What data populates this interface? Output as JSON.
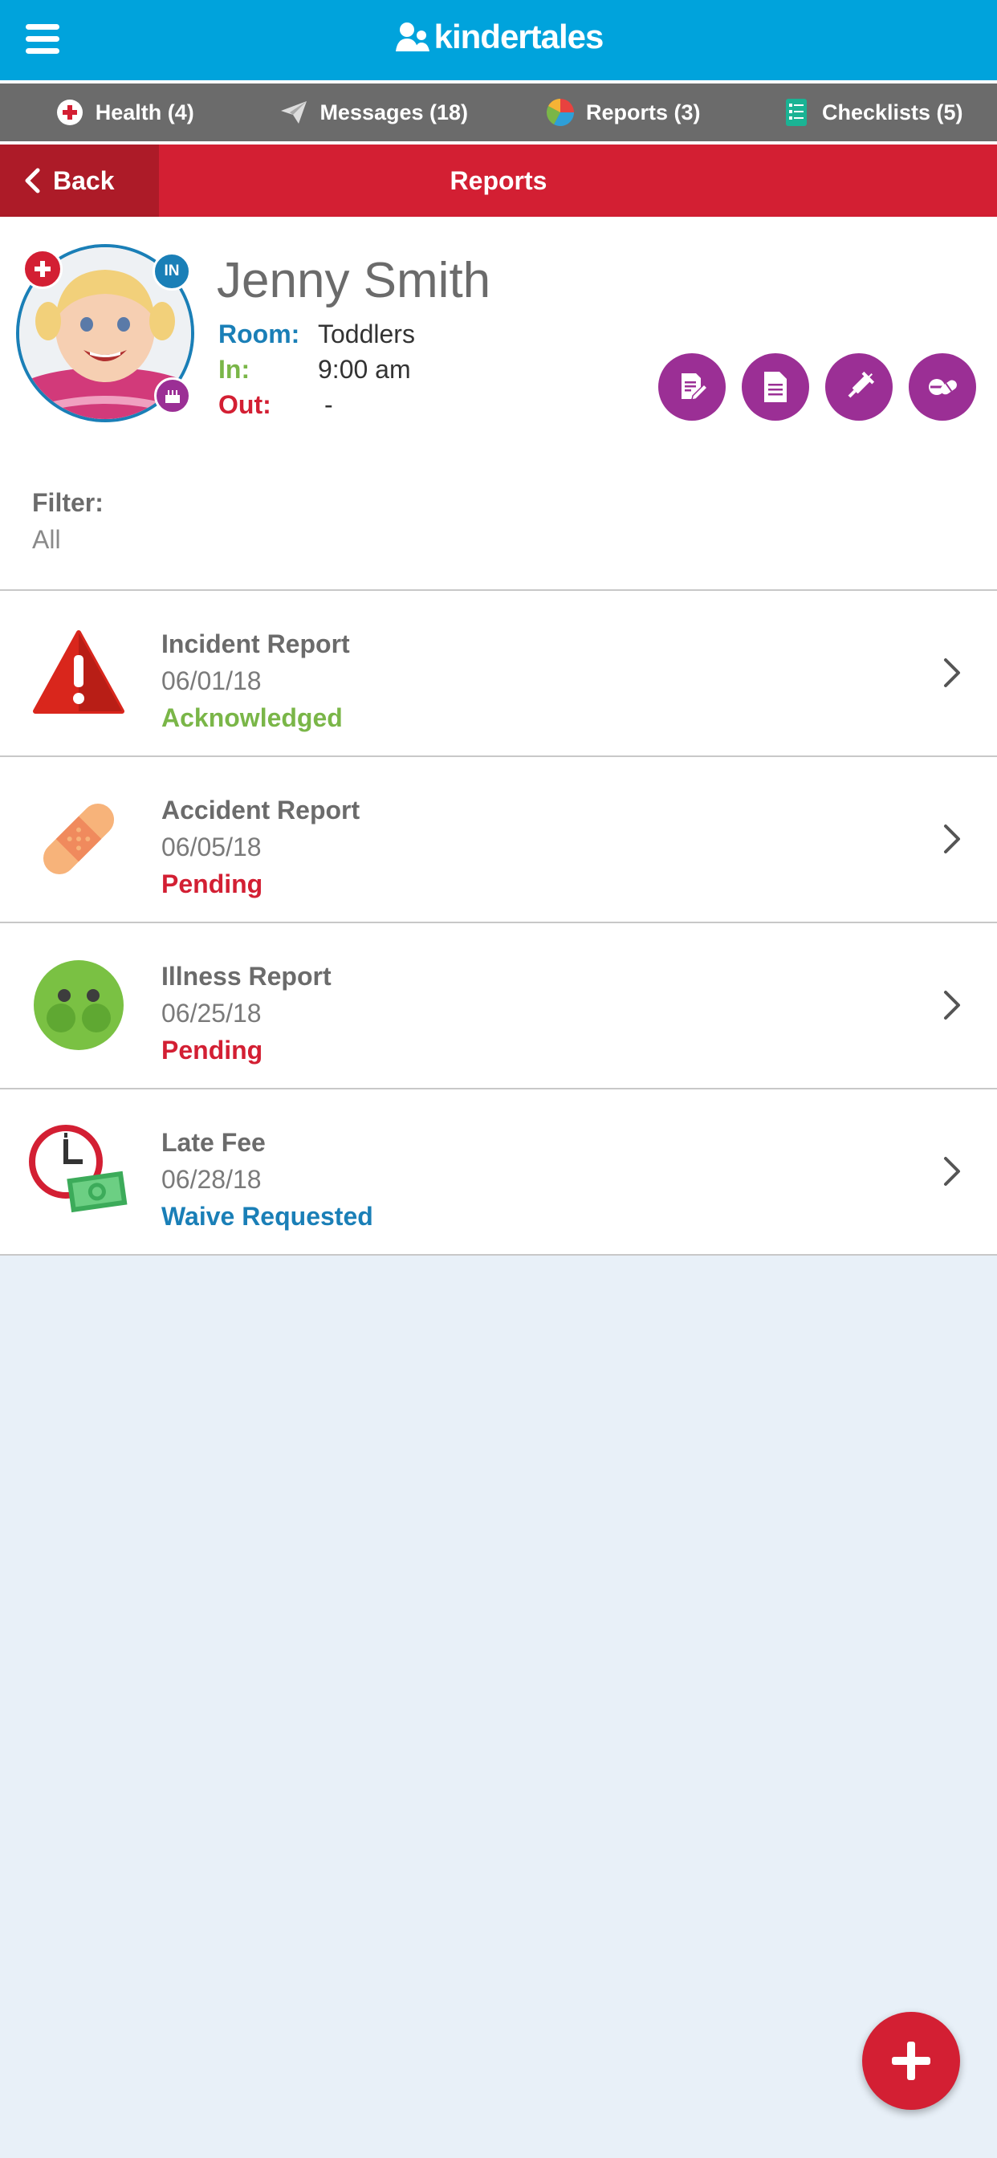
{
  "app": {
    "brand": "kindertales"
  },
  "tabs": [
    {
      "label": "Health (4)",
      "icon": "health-icon"
    },
    {
      "label": "Messages (18)",
      "icon": "send-icon"
    },
    {
      "label": "Reports (3)",
      "icon": "pie-chart-icon"
    },
    {
      "label": "Checklists (5)",
      "icon": "checklist-icon"
    }
  ],
  "header": {
    "back_label": "Back",
    "title": "Reports"
  },
  "child": {
    "name": "Jenny Smith",
    "in_badge": "IN",
    "room_label": "Room:",
    "room": "Toddlers",
    "in_label": "In:",
    "in_time": "9:00 am",
    "out_label": "Out:",
    "out_time": "-"
  },
  "filter": {
    "label": "Filter:",
    "value": "All"
  },
  "reports": [
    {
      "title": "Incident Report",
      "date": "06/01/18",
      "status": "Acknowledged",
      "icon": "warning-icon"
    },
    {
      "title": "Accident Report",
      "date": "06/05/18",
      "status": "Pending",
      "icon": "bandage-icon"
    },
    {
      "title": "Illness Report",
      "date": "06/25/18",
      "status": "Pending",
      "icon": "sick-face-icon"
    },
    {
      "title": "Late Fee",
      "date": "06/28/18",
      "status": "Waive Requested",
      "icon": "clock-money-icon"
    }
  ],
  "colors": {
    "brand_blue": "#00a3dc",
    "red": "#d31f33",
    "purple": "#9b2f95",
    "green": "#7ab648",
    "room_blue": "#1a7fb7",
    "acknowledged": "#7ab648",
    "pending": "#d31f33",
    "waive": "#1a7fb7"
  }
}
